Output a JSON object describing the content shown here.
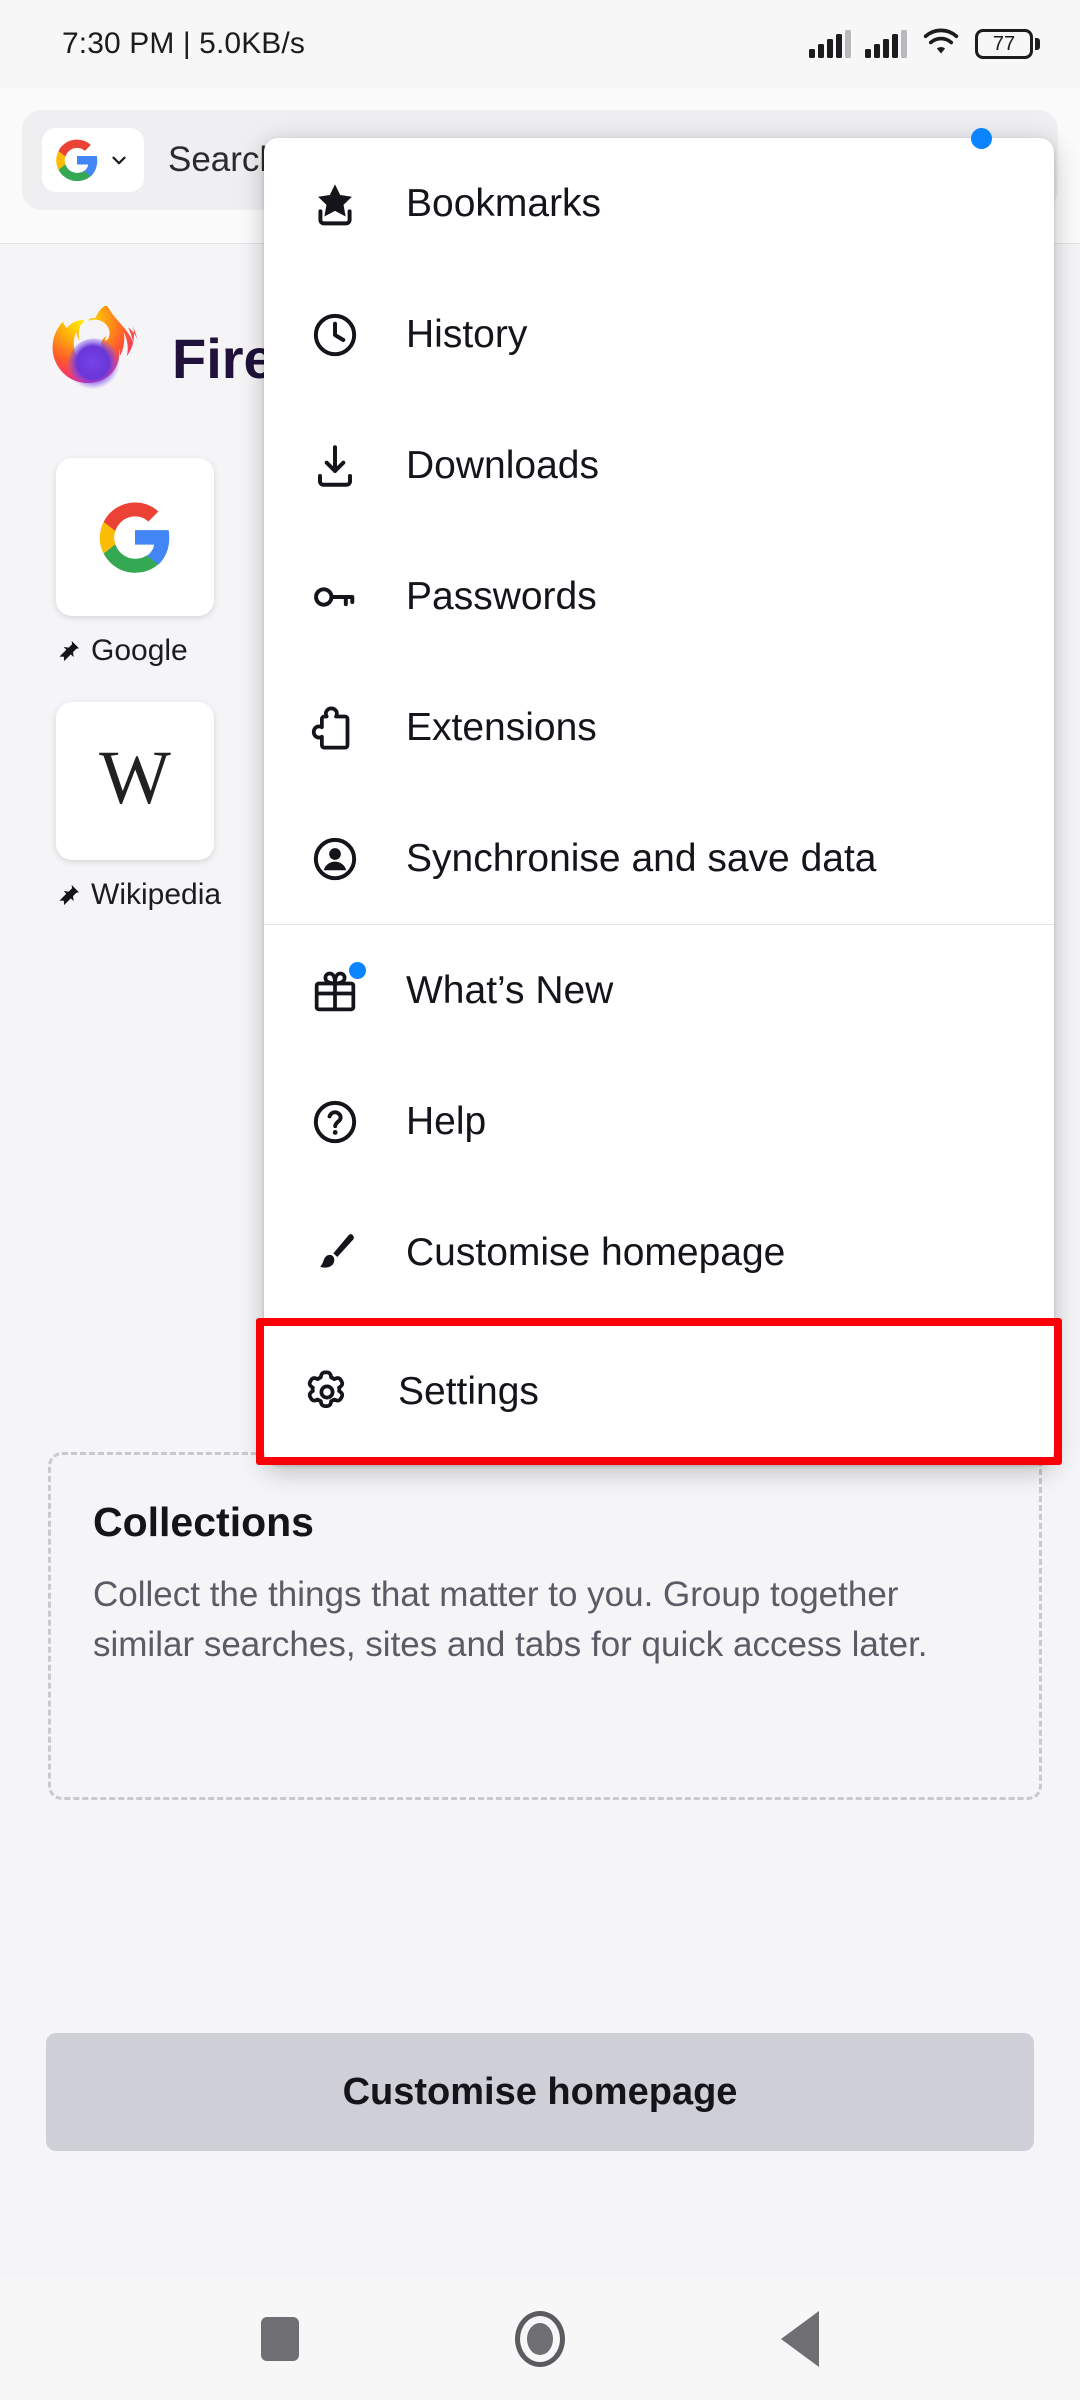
{
  "status_bar": {
    "time_and_speed": "7:30 PM | 5.0KB/s",
    "battery_level": "77",
    "icons": [
      "signal-bars-icon",
      "signal-bars-icon",
      "wifi-icon",
      "battery-icon"
    ]
  },
  "toolbar": {
    "search_engine": "Google",
    "url_text": "Search or enter address",
    "chevron": "chevron-down-icon"
  },
  "homepage": {
    "brand_name": "Firefox",
    "shortcuts": [
      {
        "label": "Google",
        "glyph": "G",
        "pin": "pin-icon"
      },
      {
        "label": "Wikipedia",
        "glyph": "W",
        "pin": "pin-icon"
      }
    ],
    "collections": {
      "title": "Collections",
      "description": "Collect the things that matter to you. Group together similar searches, sites and tabs for quick access later."
    },
    "customise_button": "Customise homepage"
  },
  "menu": {
    "has_update_badge": true,
    "group_one": [
      {
        "label": "Bookmarks",
        "icon": "bookmark-star-icon",
        "badge": false
      },
      {
        "label": "History",
        "icon": "clock-icon",
        "badge": false
      },
      {
        "label": "Downloads",
        "icon": "download-icon",
        "badge": false
      },
      {
        "label": "Passwords",
        "icon": "key-icon",
        "badge": false
      },
      {
        "label": "Extensions",
        "icon": "puzzle-piece-icon",
        "badge": false
      },
      {
        "label": "Synchronise and save data",
        "icon": "account-circle-icon",
        "badge": false
      }
    ],
    "group_two": [
      {
        "label": "What’s New",
        "icon": "gift-icon",
        "badge": true
      },
      {
        "label": "Help",
        "icon": "question-circle-icon",
        "badge": false
      },
      {
        "label": "Customise homepage",
        "icon": "paintbrush-icon",
        "badge": false
      },
      {
        "label": "Settings",
        "icon": "gear-icon",
        "badge": false,
        "highlighted": true
      }
    ]
  },
  "navbar": {
    "recents": "recents-square-icon",
    "home": "home-circle-icon",
    "back": "back-triangle-icon"
  },
  "colors": {
    "highlight": "#fb0007",
    "badge_blue": "#0a84ff",
    "firefox_purple": "#20123a"
  }
}
